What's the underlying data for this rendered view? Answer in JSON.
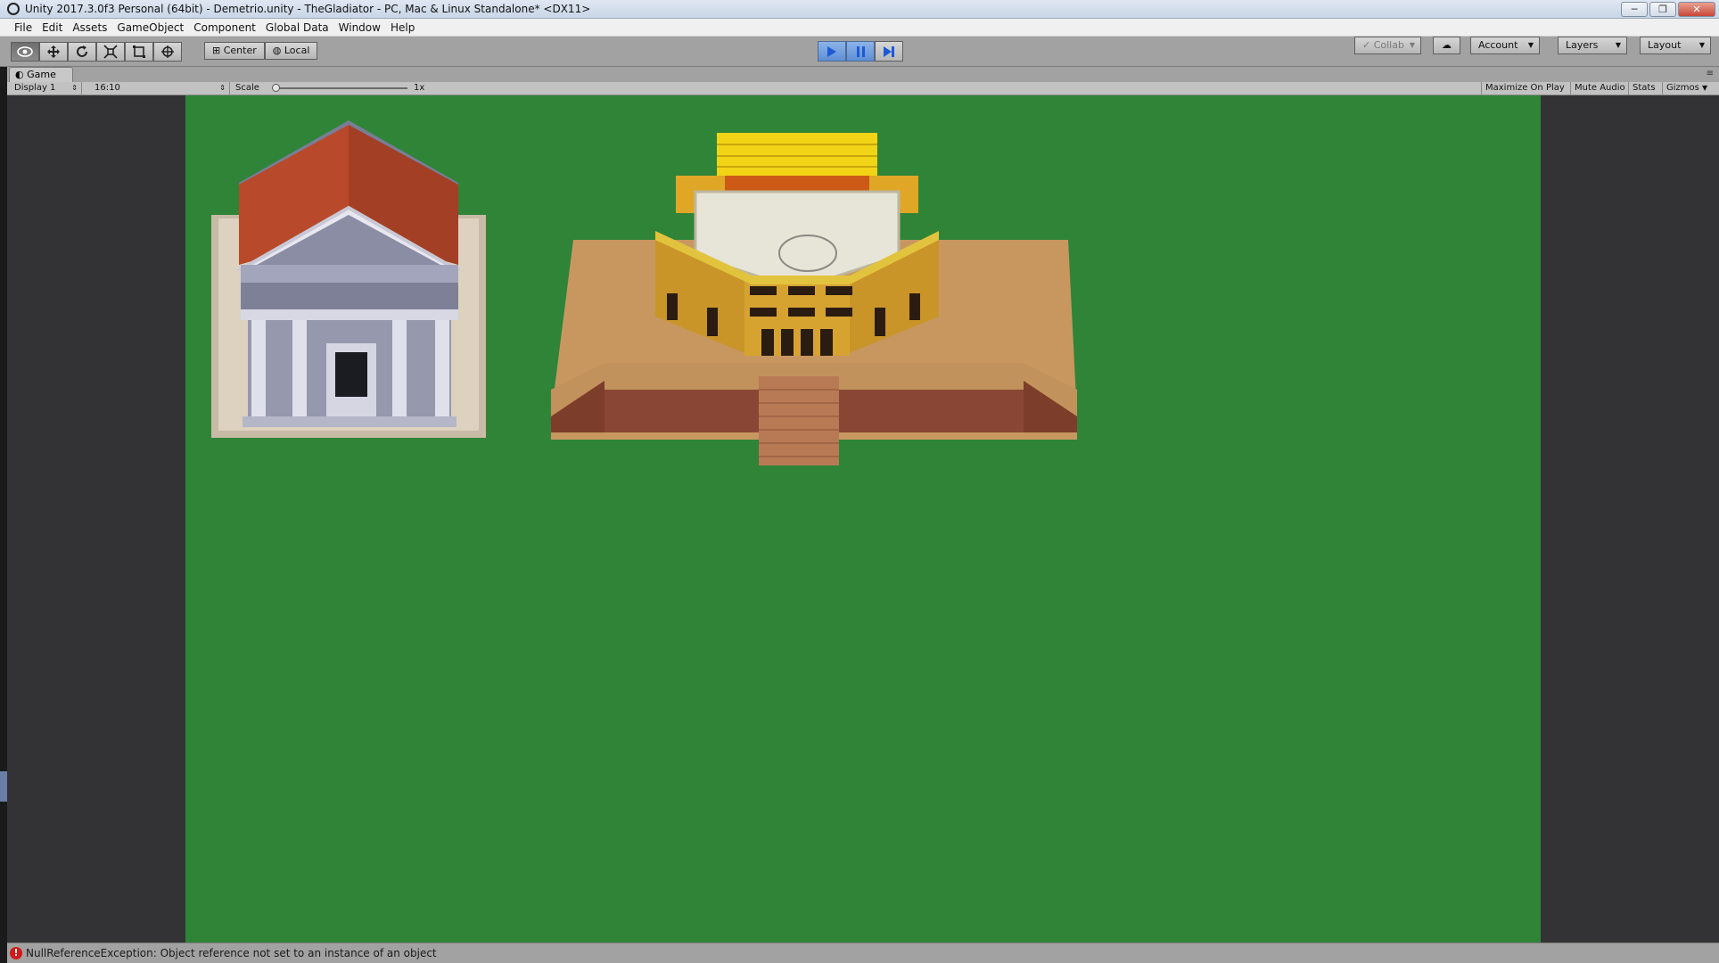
{
  "window": {
    "title": "Unity 2017.3.0f3 Personal (64bit) - Demetrio.unity - TheGladiator - PC, Mac & Linux Standalone* <DX11>",
    "minimize": "─",
    "restore": "❐",
    "close": "✕"
  },
  "menu": [
    "File",
    "Edit",
    "Assets",
    "GameObject",
    "Component",
    "Global Data",
    "Window",
    "Help"
  ],
  "toolbar": {
    "tools": [
      {
        "name": "view-tool",
        "glyph": "👁"
      },
      {
        "name": "move-tool",
        "glyph": "✥"
      },
      {
        "name": "rotate-tool",
        "glyph": "⟳"
      },
      {
        "name": "scale-tool",
        "glyph": "⤧"
      },
      {
        "name": "rect-tool",
        "glyph": "▣"
      },
      {
        "name": "transform-tool",
        "glyph": "⊕"
      }
    ],
    "pivot": "Center",
    "pivot_rotation": "Local",
    "collab": "Collab",
    "cloud": "☁",
    "account": "Account",
    "layers": "Layers",
    "layout": "Layout"
  },
  "game_tab": {
    "label": "Game",
    "display": "Display 1",
    "aspect": "16:10",
    "scale_label": "Scale",
    "scale_value": "1x",
    "scale_fraction": 0.0,
    "maximize_on_play": "Maximize On Play",
    "mute_audio": "Mute Audio",
    "stats": "Stats",
    "gizmos": "Gizmos"
  },
  "status": {
    "error_icon": "!",
    "message": "NullReferenceException: Object reference not set to an instance of an object"
  },
  "colors": {
    "game_background": "#2f8438",
    "play_blue": "#1d59d6",
    "error_red": "#d11a1a"
  }
}
